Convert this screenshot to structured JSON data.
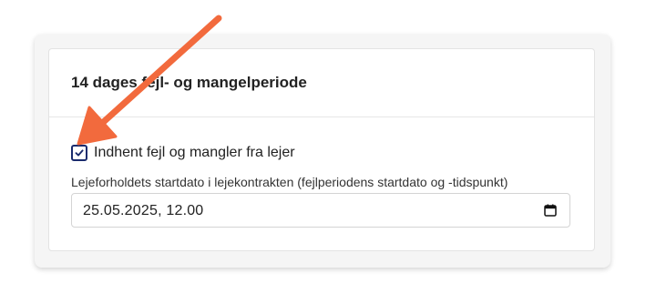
{
  "card": {
    "title": "14 dages fejl- og mangelperiode"
  },
  "checkbox": {
    "label": "Indhent fejl og mangler fra lejer",
    "checked": true
  },
  "date_field": {
    "label": "Lejeforholdets startdato i lejekontrakten (fejlperiodens startdato og -tidspunkt)",
    "value": "25.05.2025, 12.00"
  },
  "icons": {
    "calendar": "calendar-icon",
    "checkmark": "checkmark-icon",
    "annotation_arrow": "arrow-icon"
  },
  "colors": {
    "arrow": "#f26a3d",
    "checkbox_border": "#1a2b6d",
    "text": "#222222"
  }
}
